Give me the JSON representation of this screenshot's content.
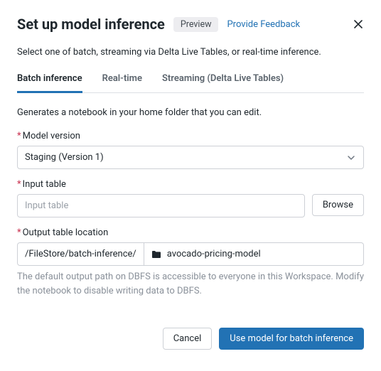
{
  "header": {
    "title": "Set up model inference",
    "badge": "Preview",
    "feedback": "Provide Feedback"
  },
  "subtitle": "Select one of batch, streaming via Delta Live Tables, or real-time inference.",
  "tabs": {
    "batch": "Batch inference",
    "realtime": "Real-time",
    "streaming": "Streaming (Delta Live Tables)"
  },
  "tab_desc": "Generates a notebook in your home folder that you can edit.",
  "fields": {
    "model_version": {
      "label": "Model version",
      "value": "Staging (Version 1)"
    },
    "input_table": {
      "label": "Input table",
      "placeholder": "Input table",
      "browse": "Browse"
    },
    "output_location": {
      "label": "Output table location",
      "prefix": "/FileStore/batch-inference/",
      "value": "avocado-pricing-model",
      "helper": "The default output path on DBFS is accessible to everyone in this Workspace. Modify the notebook to disable writing data to DBFS."
    }
  },
  "footer": {
    "cancel": "Cancel",
    "submit": "Use model for batch inference"
  }
}
